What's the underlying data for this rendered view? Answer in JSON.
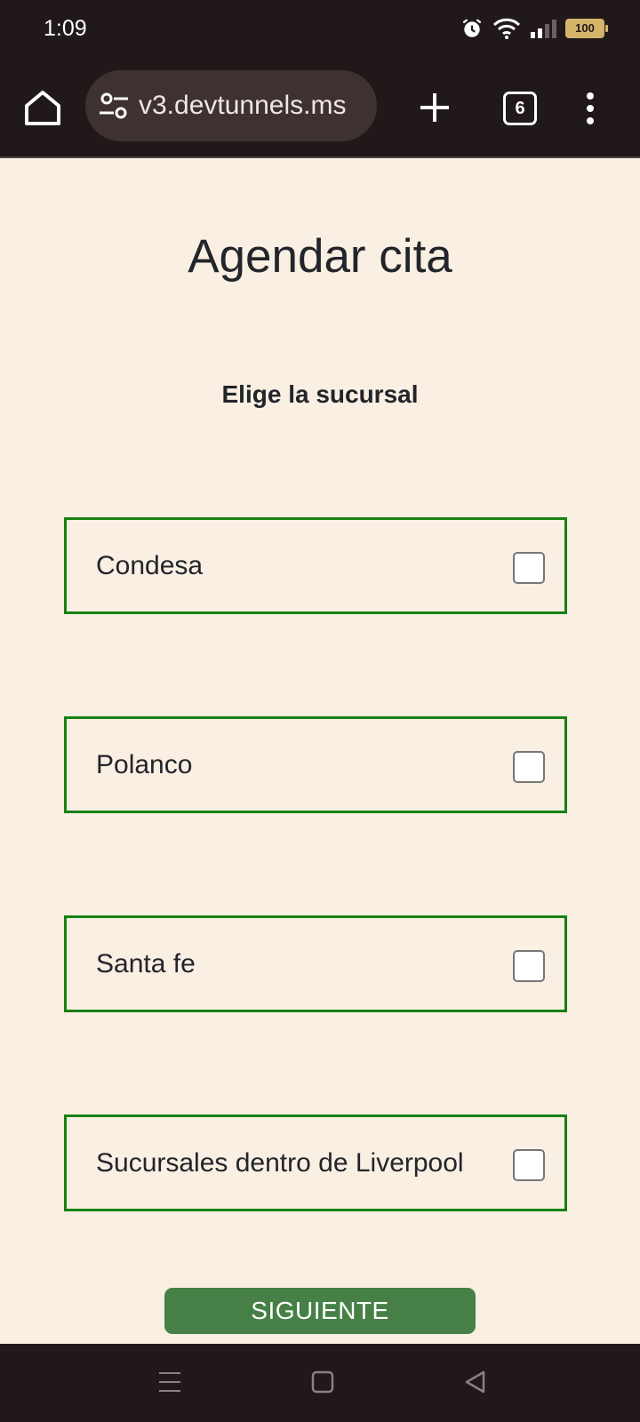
{
  "status_bar": {
    "time": "1:09",
    "battery": "100",
    "icons": [
      "alarm-icon",
      "wifi-icon",
      "signal-icon",
      "battery-icon"
    ]
  },
  "browser": {
    "url": "v3.devtunnels.ms",
    "tab_count": "6",
    "icons": [
      "home-icon",
      "site-settings-icon",
      "plus-icon",
      "tabs-icon",
      "more-vert-icon"
    ]
  },
  "page": {
    "title": "Agendar cita",
    "subtitle": "Elige la sucursal",
    "options": [
      {
        "label": "Condesa",
        "checked": false
      },
      {
        "label": "Polanco",
        "checked": false
      },
      {
        "label": "Santa fe",
        "checked": false
      },
      {
        "label": "Sucursales dentro de Liverpool",
        "checked": false
      }
    ],
    "next_label": "SIGUIENTE"
  },
  "colors": {
    "accent_border": "#178012",
    "button_green": "#468046",
    "page_background": "#faefe3",
    "chrome_dark": "#211919"
  },
  "nav_bar": {
    "icons": [
      "recents-icon",
      "home-square-icon",
      "back-icon"
    ]
  }
}
